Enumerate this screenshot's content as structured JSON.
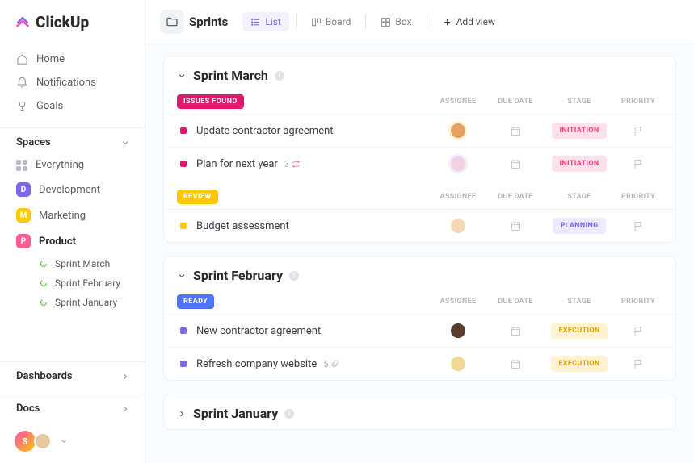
{
  "app": {
    "name": "ClickUp"
  },
  "nav": {
    "home": "Home",
    "notifications": "Notifications",
    "goals": "Goals"
  },
  "spaces": {
    "header": "Spaces",
    "everything": "Everything",
    "items": [
      {
        "label": "Development",
        "letter": "D",
        "color": "#7b68ee",
        "active": false
      },
      {
        "label": "Marketing",
        "letter": "M",
        "color": "#ffc800",
        "active": false
      },
      {
        "label": "Product",
        "letter": "P",
        "color": "#ff5c93",
        "active": true
      }
    ],
    "subs": [
      {
        "label": "Sprint  March"
      },
      {
        "label": "Sprint  February"
      },
      {
        "label": "Sprint January"
      }
    ]
  },
  "bottom": {
    "dashboards": "Dashboards",
    "docs": "Docs"
  },
  "topbar": {
    "title": "Sprints",
    "views": {
      "list": "List",
      "board": "Board",
      "box": "Box",
      "add": "Add view"
    }
  },
  "columns": {
    "assignee": "ASSIGNEE",
    "due": "DUE DATE",
    "stage": "STAGE",
    "priority": "PRIORITY"
  },
  "sprints": [
    {
      "title": "Sprint March",
      "collapsed": false,
      "groups": [
        {
          "status": "ISSUES FOUND",
          "statusColor": "#e4176e",
          "tasks": [
            {
              "name": "Update contractor agreement",
              "sq": "#e4176e",
              "avatarBg": "#e8a05f",
              "avatarRing": "#fff4d6",
              "stage": "INITIATION",
              "stageBg": "#ffe1ea",
              "stageColor": "#ff3d7f"
            },
            {
              "name": "Plan for next year",
              "sq": "#e4176e",
              "count": "3",
              "countIcon": "repeat",
              "avatarBg": "#f0d2e0",
              "avatarRing": "#f3ecff",
              "stage": "INITIATION",
              "stageBg": "#ffe1ea",
              "stageColor": "#ff3d7f"
            }
          ]
        },
        {
          "status": "REVIEW",
          "statusColor": "#ffc800",
          "tasks": [
            {
              "name": "Budget assessment",
              "sq": "#ffc800",
              "avatarBg": "#f5d8b8",
              "avatarRing": "#fff",
              "stage": "PLANNING",
              "stageBg": "#eee9ff",
              "stageColor": "#7b68ee"
            }
          ]
        }
      ]
    },
    {
      "title": "Sprint February",
      "collapsed": false,
      "groups": [
        {
          "status": "READY",
          "statusColor": "#4f74ff",
          "tasks": [
            {
              "name": "New contractor agreement",
              "sq": "#7b68ee",
              "avatarBg": "#5a3d2e",
              "avatarRing": "#fff",
              "stage": "EXECUTION",
              "stageBg": "#fff3d1",
              "stageColor": "#e0a400"
            },
            {
              "name": "Refresh company website",
              "sq": "#7b68ee",
              "count": "5",
              "countIcon": "attach",
              "avatarBg": "#f0d898",
              "avatarRing": "#fff",
              "stage": "EXECUTION",
              "stageBg": "#fff3d1",
              "stageColor": "#e0a400"
            }
          ]
        }
      ]
    },
    {
      "title": "Sprint January",
      "collapsed": true,
      "groups": []
    }
  ]
}
